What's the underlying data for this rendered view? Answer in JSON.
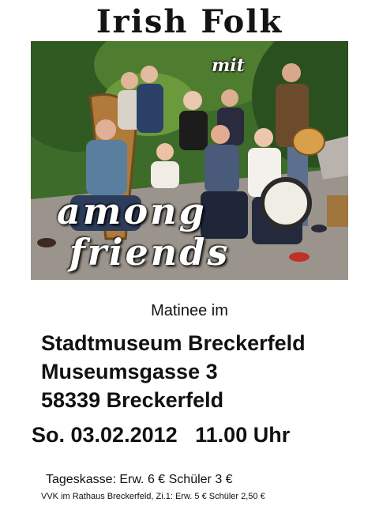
{
  "poster": {
    "title": "Irish Folk",
    "band_prefix": "mit",
    "band_name_line1": "among",
    "band_name_line2": "friends",
    "matinee": "Matinee im",
    "venue_line1": "Stadtmuseum Breckerfeld",
    "venue_line2": "Museumsgasse 3",
    "venue_line3": "58339 Breckerfeld",
    "datetime": "So. 03.02.2012   11.00 Uhr",
    "prices": "Tageskasse: Erw. 6 € Schüler 3 €",
    "presale": "VVK im Rathaus Breckerfeld, Zi.1: Erw. 5 €  Schüler 2,50 €"
  },
  "photo": {
    "subject": "band-group-photo",
    "colors": {
      "foliage_dark": "#2f5a22",
      "foliage_light": "#6b9a3c",
      "pavement": "#9a948c",
      "accent_red": "#c0302a"
    }
  }
}
